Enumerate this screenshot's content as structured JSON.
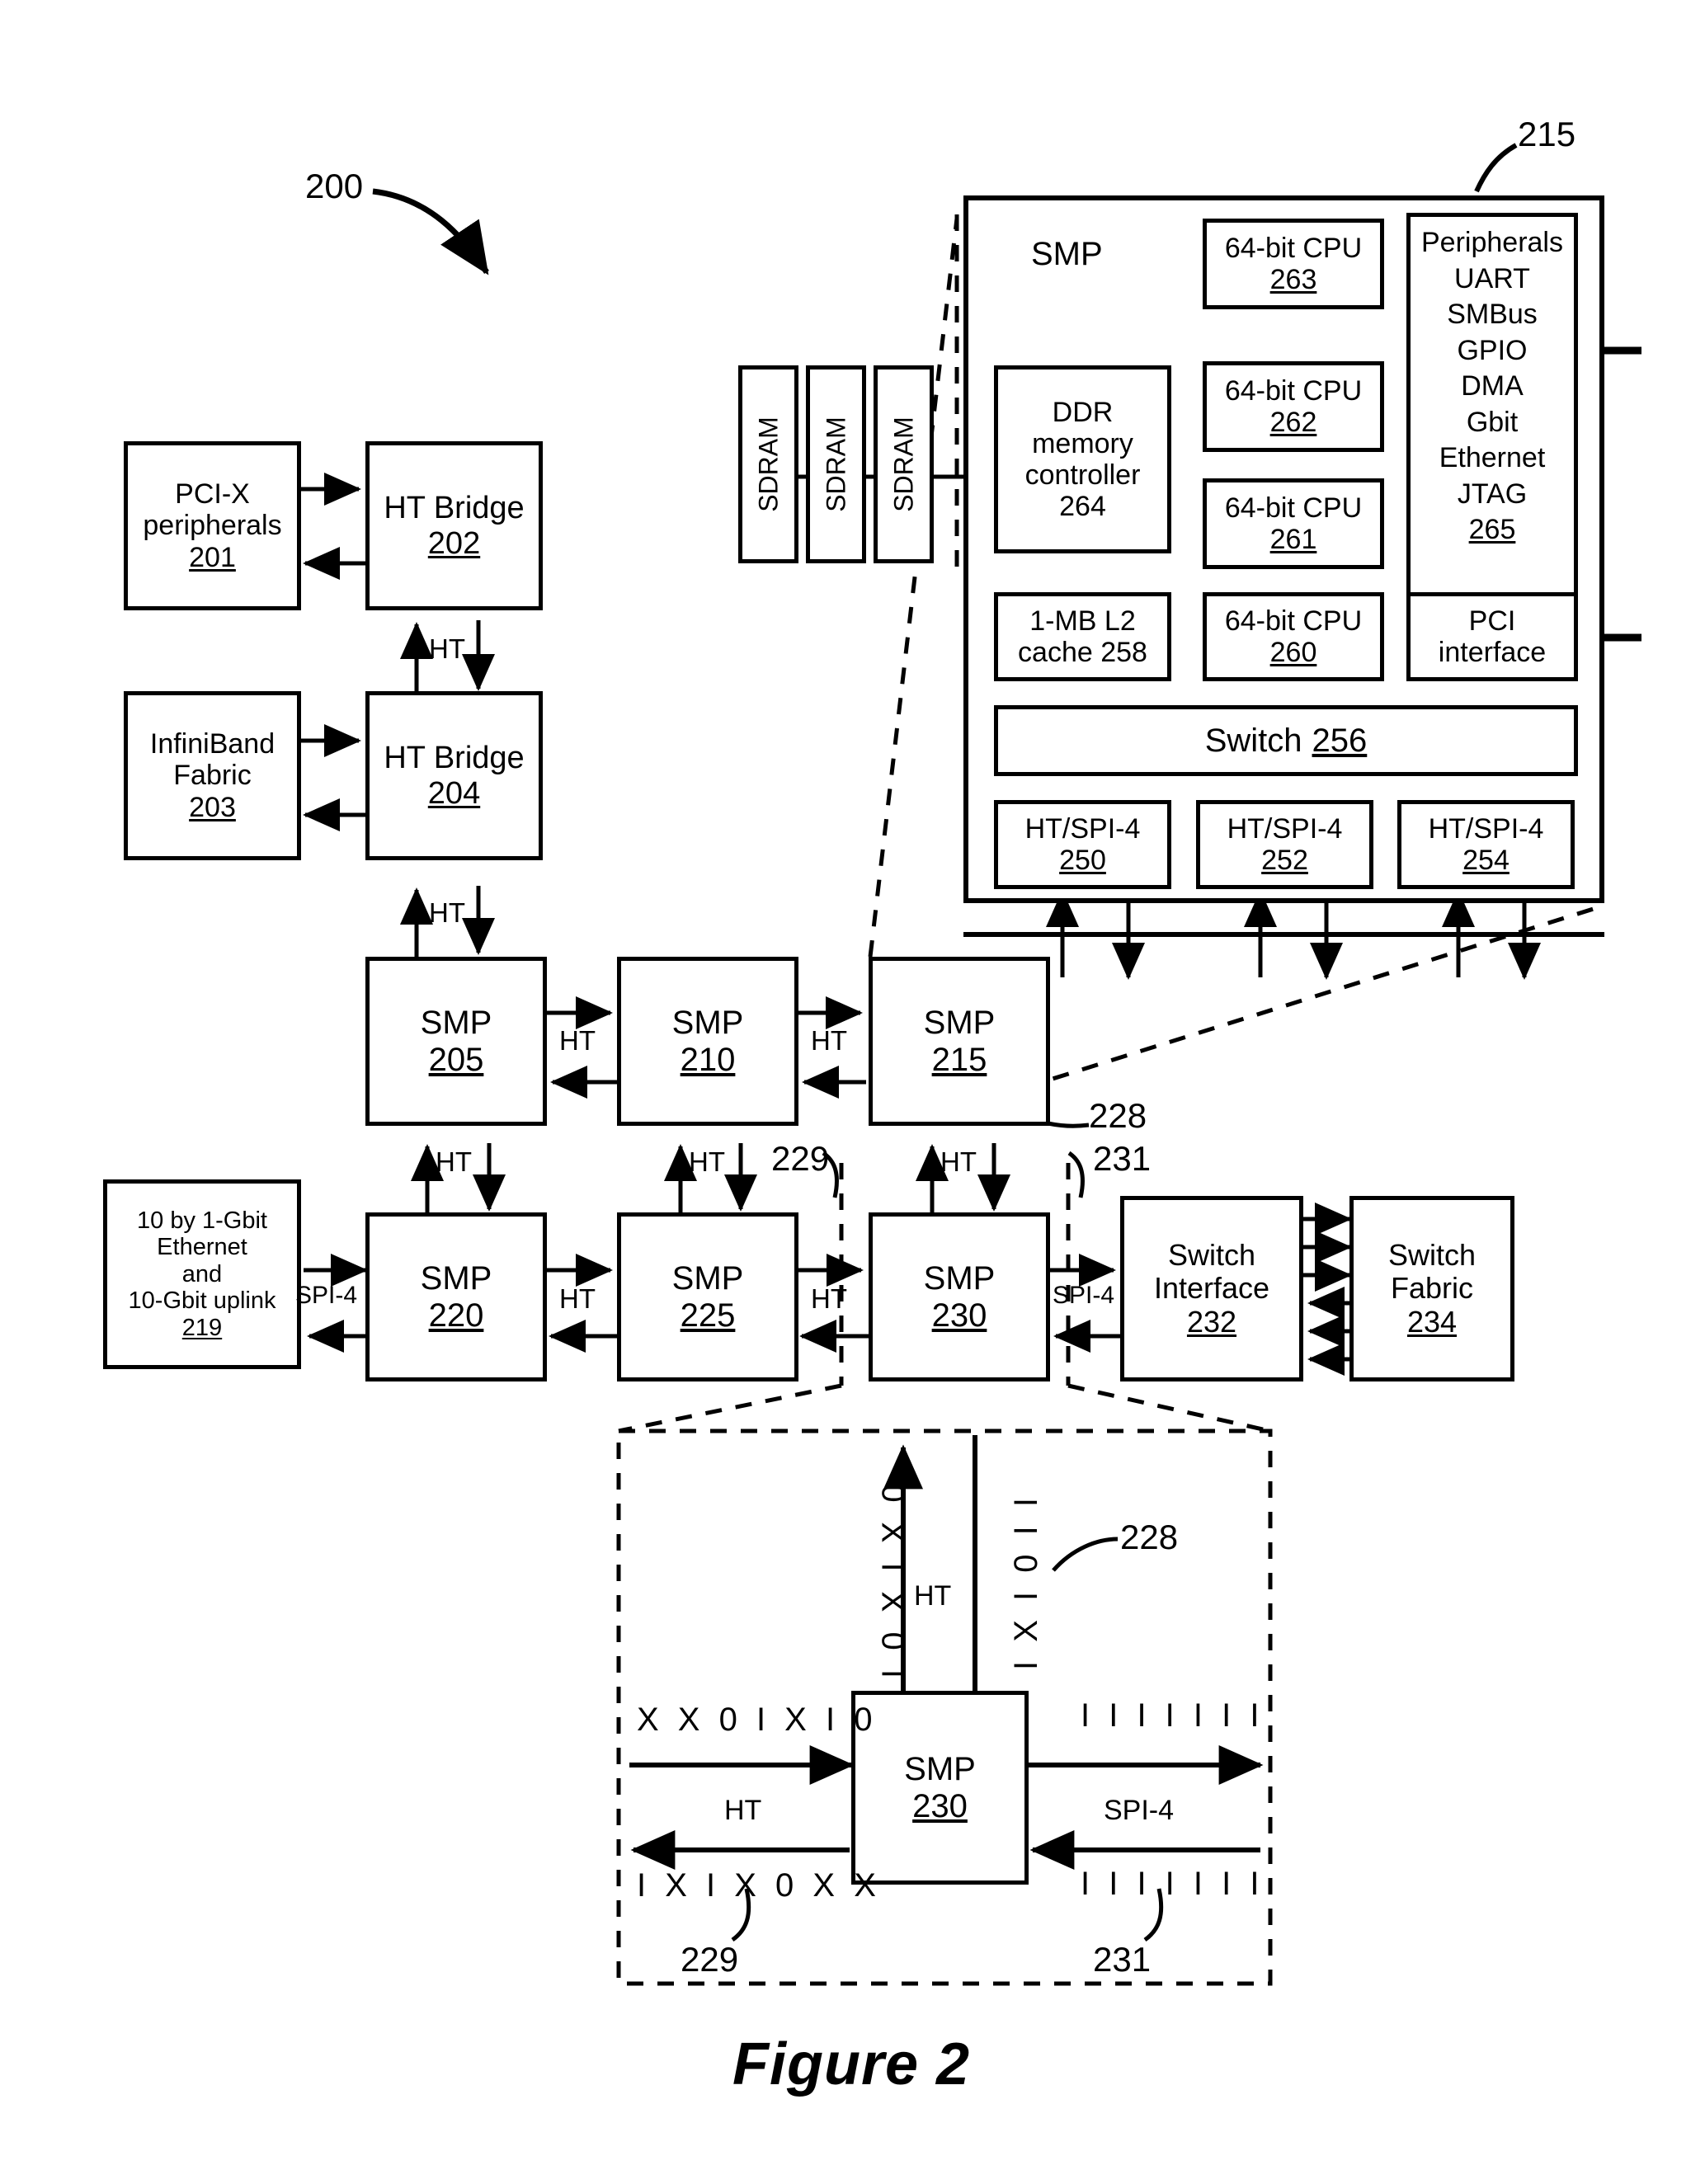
{
  "figure": {
    "caption": "Figure 2",
    "system_ref": "200"
  },
  "detail_block": {
    "ref": "215",
    "title": "SMP",
    "ddr": {
      "line1": "DDR",
      "line2": "memory",
      "line3": "controller",
      "ref": "264"
    },
    "cpus": [
      {
        "label": "64-bit CPU",
        "ref": "263"
      },
      {
        "label": "64-bit CPU",
        "ref": "262"
      },
      {
        "label": "64-bit CPU",
        "ref": "261"
      },
      {
        "label": "64-bit CPU",
        "ref": "260"
      }
    ],
    "peripherals": {
      "title": "Peripherals",
      "items": [
        "UART",
        "SMBus",
        "GPIO",
        "DMA",
        "Gbit",
        "Ethernet",
        "JTAG"
      ],
      "ref": "265"
    },
    "pci_interface": {
      "line1": "PCI",
      "line2": "interface"
    },
    "l2_cache": {
      "line1": "1-MB L2",
      "line2": "cache 258"
    },
    "switch": {
      "label": "Switch",
      "ref": "256"
    },
    "ht_spi": [
      {
        "label": "HT/SPI-4",
        "ref": "250"
      },
      {
        "label": "HT/SPI-4",
        "ref": "252"
      },
      {
        "label": "HT/SPI-4",
        "ref": "254"
      }
    ],
    "sdram": [
      "SDRAM",
      "SDRAM",
      "SDRAM"
    ]
  },
  "left_column": {
    "pcix": {
      "line1": "PCI-X",
      "line2": "peripherals",
      "ref": "201"
    },
    "ht_bridge_202": {
      "label": "HT Bridge",
      "ref": "202"
    },
    "infiniband": {
      "line1": "InfiniBand",
      "line2": "Fabric",
      "ref": "203"
    },
    "ht_bridge_204": {
      "label": "HT Bridge",
      "ref": "204"
    },
    "ethernet": {
      "line1": "10 by 1-Gbit",
      "line2": "Ethernet",
      "line3": "and",
      "line4": "10-Gbit uplink",
      "ref": "219"
    }
  },
  "smp_grid": {
    "row1": [
      {
        "label": "SMP",
        "ref": "205"
      },
      {
        "label": "SMP",
        "ref": "210"
      },
      {
        "label": "SMP",
        "ref": "215"
      }
    ],
    "row2": [
      {
        "label": "SMP",
        "ref": "220"
      },
      {
        "label": "SMP",
        "ref": "225"
      },
      {
        "label": "SMP",
        "ref": "230"
      }
    ]
  },
  "switch_side": {
    "interface": {
      "line1": "Switch",
      "line2": "Interface",
      "ref": "232"
    },
    "fabric": {
      "line1": "Switch",
      "line2": "Fabric",
      "ref": "234"
    }
  },
  "link_labels": {
    "ht": "HT",
    "spi4": "SPI-4"
  },
  "callout_refs": {
    "c228": "228",
    "c229": "229",
    "c231": "231"
  },
  "detail_callout": {
    "smp": {
      "label": "SMP",
      "ref": "230"
    },
    "ht_label": "HT",
    "spi4_label": "SPI-4",
    "bits_in_ht": "X X 0 I X I 0",
    "bits_out_ht": "I X I X 0 X X",
    "bits_up_vertical": "I 0 X I X 0",
    "bits_down_vertical": "I X I 0 I I",
    "bits_out_spi4": "I I I I I I I",
    "bits_in_spi4": "I I I I I I I",
    "ref_228": "228",
    "ref_229": "229",
    "ref_231": "231"
  }
}
